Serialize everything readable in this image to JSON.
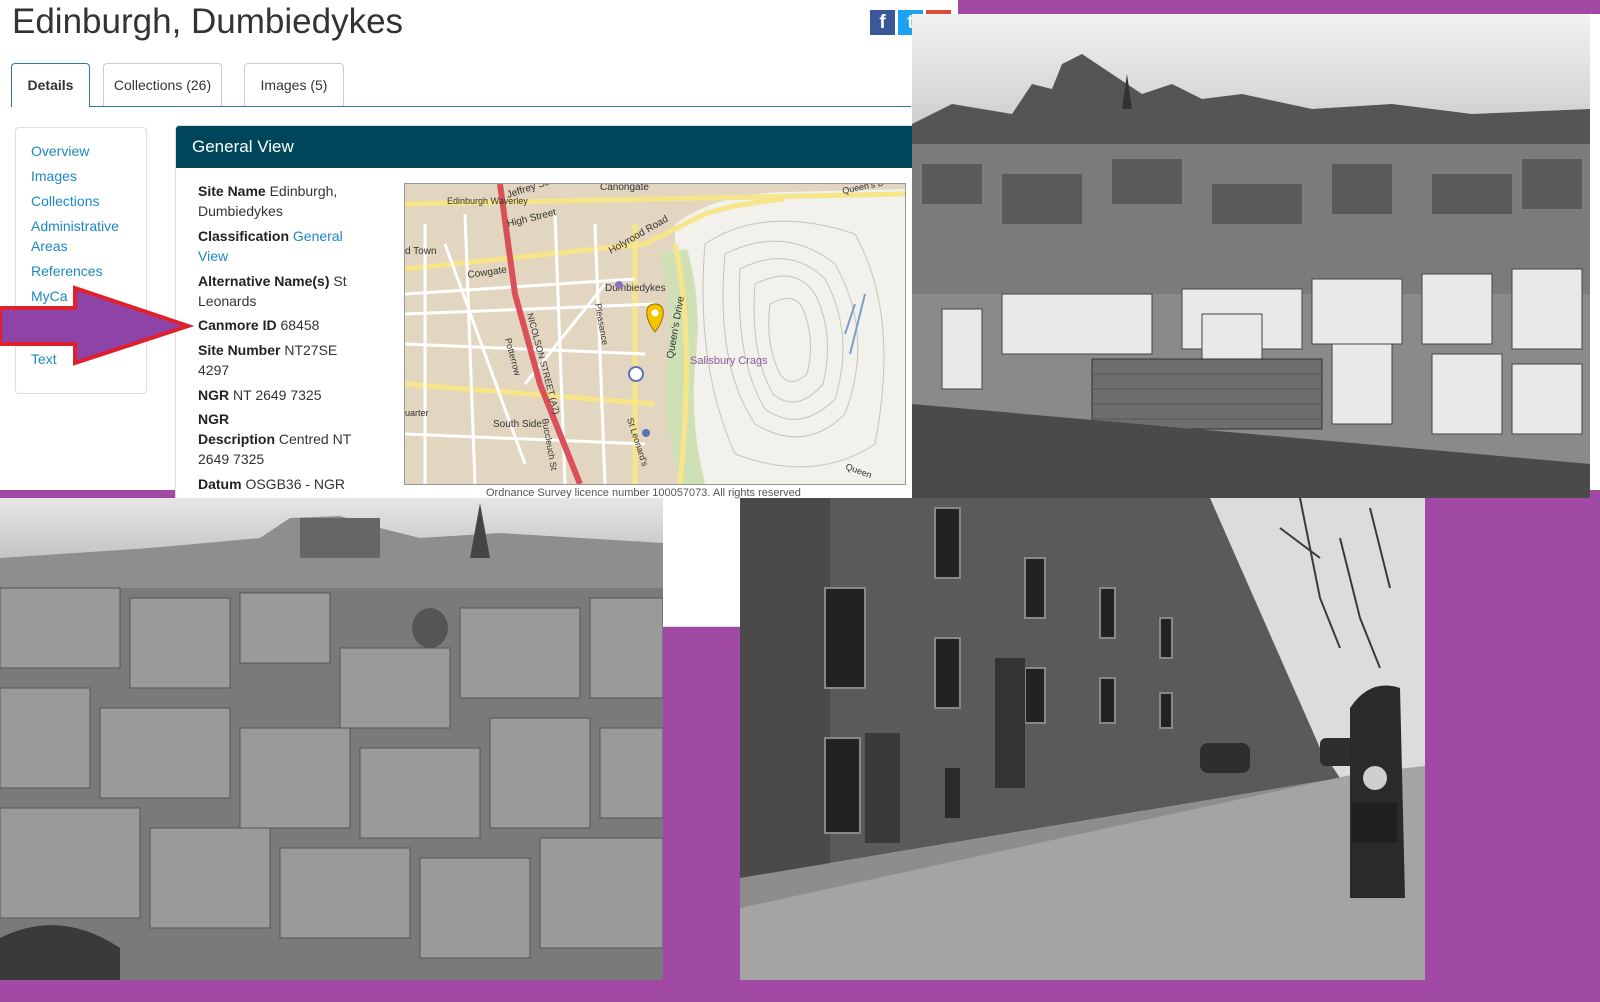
{
  "page": {
    "title": "Edinburgh, Dumbiedykes"
  },
  "social": {
    "facebook": "f",
    "twitter": "t",
    "google": "g"
  },
  "tabs": [
    {
      "label": "Details"
    },
    {
      "label": "Collections (26)"
    },
    {
      "label": "Images (5)"
    }
  ],
  "sidenav": {
    "items": [
      {
        "label": "Overview"
      },
      {
        "label": "Images"
      },
      {
        "label": "Collections"
      },
      {
        "label": "Administrative"
      },
      {
        "label": "Areas"
      },
      {
        "label": "References"
      },
      {
        "label": "MyCa"
      },
      {
        "label": "Text"
      }
    ]
  },
  "panel": {
    "heading": "General View",
    "site_name_label": "Site Name",
    "site_name_value": "Edinburgh,",
    "site_name_value_2": "Dumbiedykes",
    "classification_label": "Classification",
    "classification_value": "General",
    "classification_value_2": "View",
    "alt_name_label": "Alternative Name(s)",
    "alt_name_value": "St",
    "alt_name_value_2": "Leonards",
    "canmore_label": "Canmore ID",
    "canmore_value": "68458",
    "site_number_label": "Site Number",
    "site_number_value": "NT27SE",
    "site_number_value_2": "4297",
    "ngr_label": "NGR",
    "ngr_value": "NT 2649 7325",
    "ngr_desc_label_1": "NGR",
    "ngr_desc_label_2": "Description",
    "ngr_desc_value": "Centred NT",
    "ngr_desc_value_2": "2649 7325",
    "datum_label": "Datum",
    "datum_value": "OSGB36 - NGR"
  },
  "map": {
    "labels": {
      "canongate": "Canongate",
      "jeffrey": "Jeffrey Street",
      "waverley": "Edinburgh Waverley",
      "high_street": "High Street",
      "holyrood": "Holyrood Road",
      "old_town": "d Town",
      "cowgate": "Cowgate",
      "dumbiedykes": "Dumbiedykes",
      "queens_drive": "Queen's Drive",
      "salisbury": "Salisbury Crags",
      "nicolson": "NICOLSON STREET (A7)",
      "potterrow": "Potterrow",
      "pleasance": "Pleasance",
      "south_side": "South Side",
      "buccleuch": "Buccleuch St",
      "st_leonards": "St Leonard's",
      "queens_top": "Queen's D",
      "queen_bottom": "Queen",
      "quarter": "uarter"
    },
    "credit": "Ordnance Survey licence number 100057073. All rights reserved"
  },
  "colors": {
    "accent_purple": "#a04aa6",
    "panel_header": "#00465a",
    "link": "#1d87c6",
    "arrow_fill": "#8e44a7",
    "arrow_stroke": "#e0202a",
    "marker": "#f5c400"
  },
  "icons": {
    "arrow": "right-arrow-annotation",
    "marker": "map-pin-icon"
  }
}
